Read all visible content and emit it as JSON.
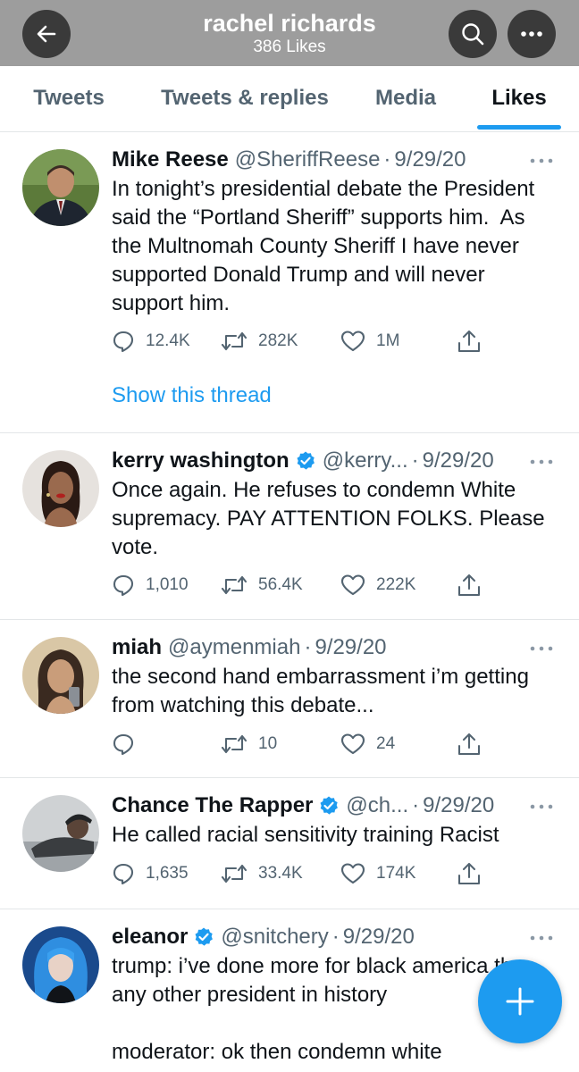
{
  "header": {
    "title": "rachel richards",
    "subtitle": "386 Likes",
    "back_icon": "arrow-left-icon",
    "search_icon": "search-icon",
    "more_icon": "more-horizontal-icon",
    "background": "#9d9d9d"
  },
  "tabs": [
    {
      "label": "Tweets",
      "active": false
    },
    {
      "label": "Tweets & replies",
      "active": false
    },
    {
      "label": "Media",
      "active": false
    },
    {
      "label": "Likes",
      "active": true
    }
  ],
  "tweets": [
    {
      "name": "Mike Reese",
      "verified": false,
      "handle": "@SheriffReese",
      "separator": "·",
      "date": "9/29/20",
      "text": "In tonight’s presidential debate the President said the “Portland Sheriff” supports him.  As the Multnomah County Sheriff I have never supported Donald Trump and will never support him.",
      "replies": "12.4K",
      "retweets": "282K",
      "likes": "1M",
      "thread_link": "Show this thread"
    },
    {
      "name": "kerry washington",
      "verified": true,
      "handle": "@kerry...",
      "separator": "·",
      "date": "9/29/20",
      "text": "Once again. He refuses to condemn White supremacy. PAY ATTENTION FOLKS. Please vote.",
      "replies": "1,010",
      "retweets": "56.4K",
      "likes": "222K"
    },
    {
      "name": "miah",
      "verified": false,
      "handle": "@aymenmiah",
      "separator": "·",
      "date": "9/29/20",
      "text": "the second hand embarrassment i’m getting from watching this debate...",
      "replies": "",
      "retweets": "10",
      "likes": "24"
    },
    {
      "name": "Chance The Rapper",
      "verified": true,
      "handle": "@ch...",
      "separator": "·",
      "date": "9/29/20",
      "text": "He called racial sensitivity training Racist",
      "replies": "1,635",
      "retweets": "33.4K",
      "likes": "174K"
    },
    {
      "name": "eleanor",
      "verified": true,
      "handle": "@snitchery",
      "separator": "·",
      "date": "9/29/20",
      "text": "trump: i’ve done more for black america than any other president in history\n\nmoderator: ok then condemn white"
    }
  ],
  "icons": {
    "reply": "reply-icon",
    "retweet": "retweet-icon",
    "like": "heart-icon",
    "share": "share-icon",
    "verified": "verified-badge-icon",
    "more": "more-options-icon",
    "compose": "plus-icon"
  },
  "colors": {
    "accent": "#1d9bf0",
    "text": "#0f1419",
    "secondary": "#536471",
    "divider": "#e3e6e8"
  }
}
